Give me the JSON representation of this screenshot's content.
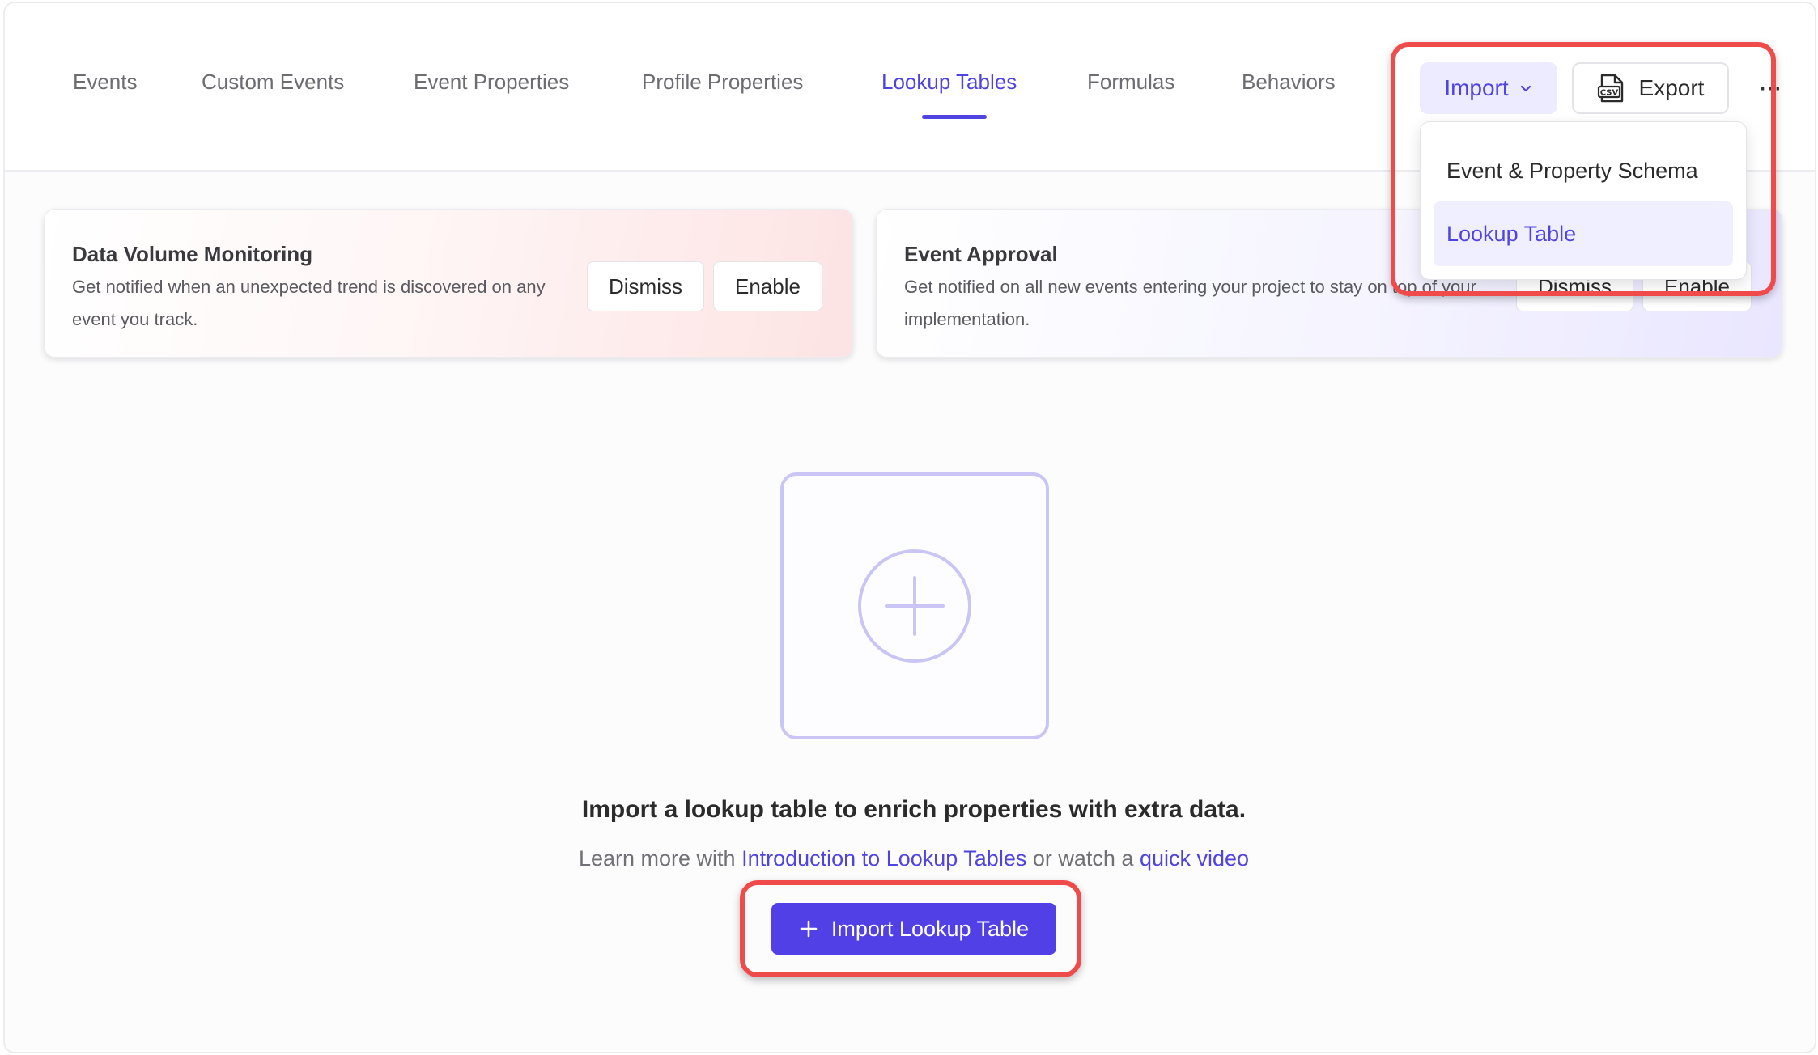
{
  "nav": {
    "tabs": [
      {
        "label": "Events"
      },
      {
        "label": "Custom Events"
      },
      {
        "label": "Event Properties"
      },
      {
        "label": "Profile Properties"
      },
      {
        "label": "Lookup Tables",
        "active": true
      },
      {
        "label": "Formulas"
      },
      {
        "label": "Behaviors"
      }
    ]
  },
  "toolbar": {
    "import_label": "Import",
    "export_label": "Export",
    "more_label": "···"
  },
  "import_menu": {
    "items": [
      {
        "label": "Event & Property Schema"
      },
      {
        "label": "Lookup Table",
        "selected": true
      }
    ]
  },
  "banners": [
    {
      "title": "Data Volume Monitoring",
      "text": "Get notified when an unexpected trend is discovered on any event you track.",
      "dismiss_label": "Dismiss",
      "enable_label": "Enable"
    },
    {
      "title": "Event Approval",
      "text": "Get notified on all new events entering your project to stay on top of your implementation.",
      "dismiss_label": "Dismiss",
      "enable_label": "Enable"
    }
  ],
  "empty_state": {
    "title": "Import a lookup table to enrich properties with extra data.",
    "learn_prefix": "Learn more with",
    "link_intro": "Introduction to Lookup Tables",
    "or_text": "or watch a",
    "link_video": "quick video",
    "button_label": "Import Lookup Table"
  },
  "colors": {
    "accent": "#4f44e0",
    "primary_button": "#5140e6",
    "highlight": "#ef4b4b"
  }
}
